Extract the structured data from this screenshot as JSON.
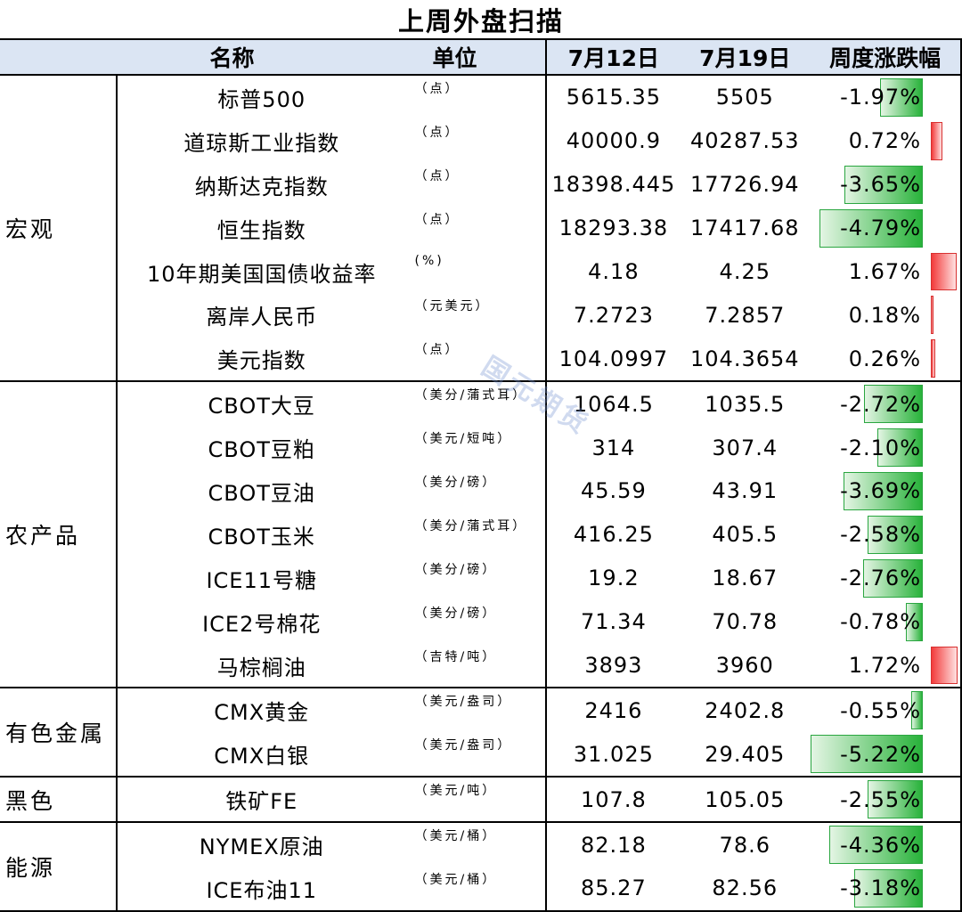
{
  "title": "上周外盘扫描",
  "headers": {
    "name": "名称",
    "unit": "单位",
    "date1": "7月12日",
    "date2": "7月19日",
    "change": "周度涨跌幅"
  },
  "watermark": "国元期货",
  "colors": {
    "header_bg": "#dbe5f3",
    "negative_bar": "#28b23a",
    "positive_bar": "#f23b3b"
  },
  "groups": [
    {
      "category": "宏观",
      "rows": [
        {
          "name": "标普500",
          "unit": "（点）",
          "v1": "5615.35",
          "v2": "5505",
          "change": "-1.97%",
          "pct": -1.97
        },
        {
          "name": "道琼斯工业指数",
          "unit": "（点）",
          "v1": "40000.9",
          "v2": "40287.53",
          "change": "0.72%",
          "pct": 0.72
        },
        {
          "name": "纳斯达克指数",
          "unit": "（点）",
          "v1": "18398.445",
          "v2": "17726.94",
          "change": "-3.65%",
          "pct": -3.65
        },
        {
          "name": "恒生指数",
          "unit": "（点）",
          "v1": "18293.38",
          "v2": "17417.68",
          "change": "-4.79%",
          "pct": -4.79
        },
        {
          "name": "10年期美国国债收益率",
          "unit": "(%)",
          "v1": "4.18",
          "v2": "4.25",
          "change": "1.67%",
          "pct": 1.67
        },
        {
          "name": "离岸人民币",
          "unit": "（元美元）",
          "v1": "7.2723",
          "v2": "7.2857",
          "change": "0.18%",
          "pct": 0.18
        },
        {
          "name": "美元指数",
          "unit": "（点）",
          "v1": "104.0997",
          "v2": "104.3654",
          "change": "0.26%",
          "pct": 0.26
        }
      ]
    },
    {
      "category": "农产品",
      "rows": [
        {
          "name": "CBOT大豆",
          "unit": "（美分/蒲式耳）",
          "v1": "1064.5",
          "v2": "1035.5",
          "change": "-2.72%",
          "pct": -2.72
        },
        {
          "name": "CBOT豆粕",
          "unit": "（美元/短吨）",
          "v1": "314",
          "v2": "307.4",
          "change": "-2.10%",
          "pct": -2.1
        },
        {
          "name": "CBOT豆油",
          "unit": "（美分/磅）",
          "v1": "45.59",
          "v2": "43.91",
          "change": "-3.69%",
          "pct": -3.69
        },
        {
          "name": "CBOT玉米",
          "unit": "（美分/蒲式耳）",
          "v1": "416.25",
          "v2": "405.5",
          "change": "-2.58%",
          "pct": -2.58
        },
        {
          "name": "ICE11号糖",
          "unit": "（美分/磅）",
          "v1": "19.2",
          "v2": "18.67",
          "change": "-2.76%",
          "pct": -2.76
        },
        {
          "name": "ICE2号棉花",
          "unit": "（美分/磅）",
          "v1": "71.34",
          "v2": "70.78",
          "change": "-0.78%",
          "pct": -0.78
        },
        {
          "name": "马棕榈油",
          "unit": "（吉特/吨）",
          "v1": "3893",
          "v2": "3960",
          "change": "1.72%",
          "pct": 1.72
        }
      ]
    },
    {
      "category": "有色金属",
      "rows": [
        {
          "name": "CMX黄金",
          "unit": "（美元/盎司）",
          "v1": "2416",
          "v2": "2402.8",
          "change": "-0.55%",
          "pct": -0.55
        },
        {
          "name": "CMX白银",
          "unit": "（美元/盎司）",
          "v1": "31.025",
          "v2": "29.405",
          "change": "-5.22%",
          "pct": -5.22
        }
      ]
    },
    {
      "category": "黑色",
      "rows": [
        {
          "name": "铁矿FE",
          "unit": "（美元/吨）",
          "v1": "107.8",
          "v2": "105.05",
          "change": "-2.55%",
          "pct": -2.55
        }
      ]
    },
    {
      "category": "能源",
      "rows": [
        {
          "name": "NYMEX原油",
          "unit": "（美元/桶）",
          "v1": "82.18",
          "v2": "78.6",
          "change": "-4.36%",
          "pct": -4.36
        },
        {
          "name": "ICE布油11",
          "unit": "（美元/桶）",
          "v1": "85.27",
          "v2": "82.56",
          "change": "-3.18%",
          "pct": -3.18
        }
      ]
    }
  ]
}
